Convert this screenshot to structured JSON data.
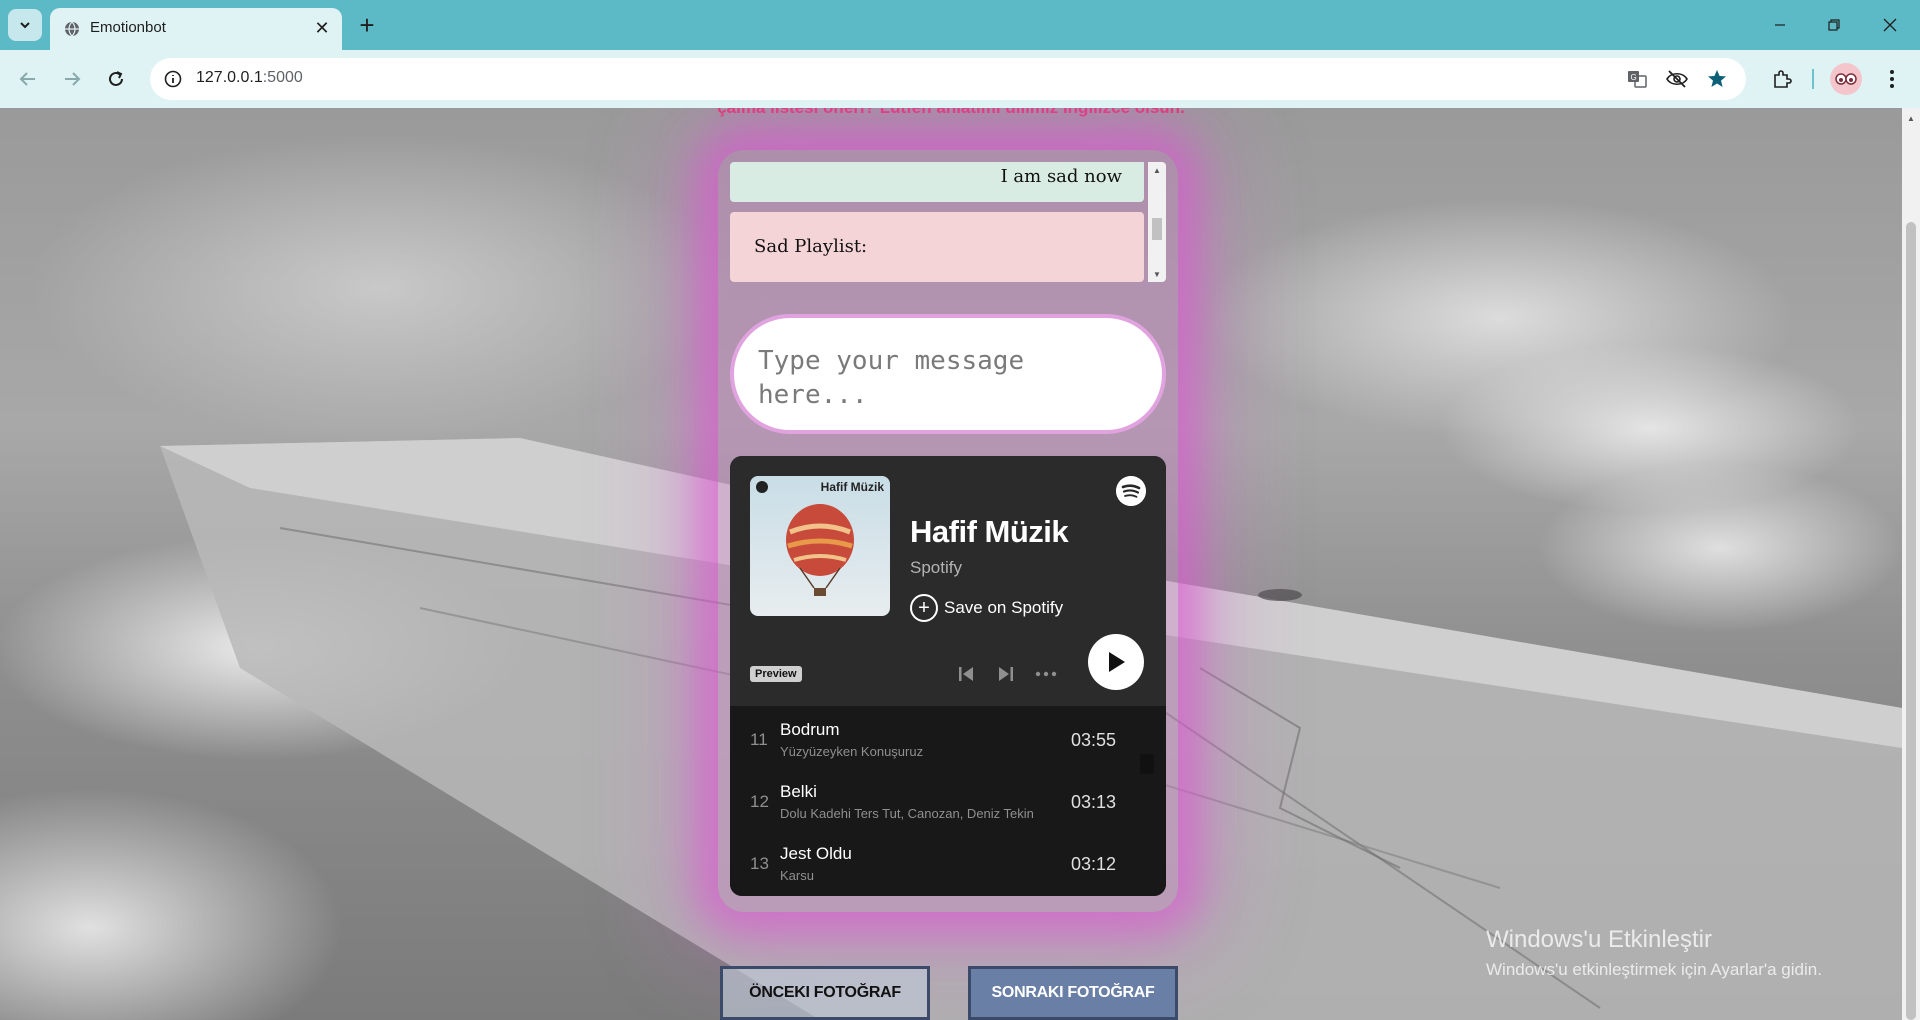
{
  "browser": {
    "tab_title": "Emotionbot",
    "url_host": "127.0.0.1",
    "url_port": ":5000",
    "icons": [
      "tab-search-icon",
      "globe-icon",
      "close-icon",
      "plus-icon",
      "minimize-icon",
      "restore-icon",
      "close-window-icon",
      "back-icon",
      "forward-icon",
      "reload-icon",
      "site-info-icon",
      "translate-icon",
      "eye-off-icon",
      "bookmark-star-icon",
      "extensions-icon",
      "profile-avatar-icon",
      "kebab-menu-icon"
    ]
  },
  "page": {
    "top_text": "çalma listesi öneri? Lütfen anlatımı dilimiz İngilizce olsun.",
    "chat": {
      "user_message": "I am sad now",
      "bot_message": "Sad Playlist:"
    },
    "input": {
      "placeholder": "Type your message here..."
    },
    "spotify": {
      "cover_title": "Hafif Müzik",
      "playlist_title": "Hafif Müzik",
      "subtitle": "Spotify",
      "save_label": "Save on Spotify",
      "preview_label": "Preview",
      "tracks": [
        {
          "no": "11",
          "name": "Bodrum",
          "artist": "Yüzyüzeyken Konuşuruz",
          "duration": "03:55"
        },
        {
          "no": "12",
          "name": "Belki",
          "artist": "Dolu Kadehi Ters Tut, Canozan, Deniz Tekin",
          "duration": "03:13"
        },
        {
          "no": "13",
          "name": "Jest Oldu",
          "artist": "Karsu",
          "duration": "03:12"
        }
      ]
    },
    "buttons": {
      "prev_photo": "ÖNCEKI FOTOĞRAF",
      "next_photo": "SONRAKI FOTOĞRAF"
    },
    "activation": {
      "line1": "Windows'u Etkinleştir",
      "line2": "Windows'u etkinleştirmek için Ayarlar'a gidin."
    }
  },
  "colors": {
    "chrome": "#5bbac5",
    "accent_pink": "#e0356b",
    "glow": "#dc50d2",
    "spotify_bg": "#282828"
  }
}
